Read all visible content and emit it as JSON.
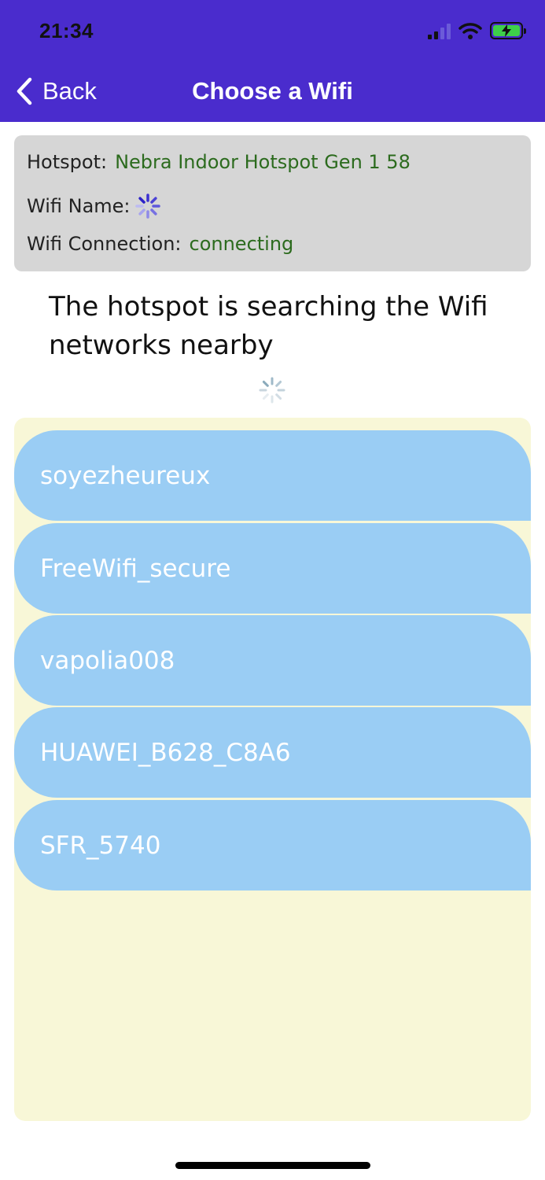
{
  "status_bar": {
    "time": "21:34"
  },
  "nav": {
    "back_label": "Back",
    "title": "Choose a Wifi"
  },
  "info": {
    "hotspot_label": "Hotspot:",
    "hotspot_value": "Nebra Indoor Hotspot Gen 1 58",
    "wifi_name_label": "Wifi Name:",
    "connection_label": "Wifi Connection:",
    "connection_value": "connecting"
  },
  "search_message": "The hotspot is searching the Wifi networks nearby",
  "networks": [
    {
      "name": "soyezheureux"
    },
    {
      "name": "FreeWifi_secure"
    },
    {
      "name": "vapolia008"
    },
    {
      "name": "HUAWEI_B628_C8A6"
    },
    {
      "name": "SFR_5740"
    }
  ],
  "colors": {
    "header": "#4a2ccd",
    "value_text": "#2c6b1e",
    "list_bg": "#f8f7d7",
    "item_bg": "#9acdf4"
  }
}
